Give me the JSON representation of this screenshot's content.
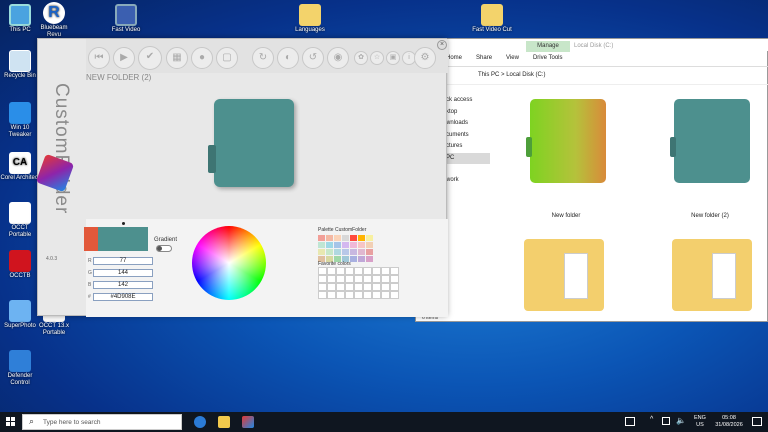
{
  "desktop": {
    "icons": [
      {
        "label": "This PC"
      },
      {
        "label": "Bluebeam Revu"
      },
      {
        "label": "Fast Video"
      },
      {
        "label": "Languages"
      },
      {
        "label": "Fast Video Cut"
      },
      {
        "label": "Recycle Bin"
      },
      {
        "label": "Win 10 Tweaker"
      },
      {
        "label": "Corel Architect"
      },
      {
        "label": "OCCT Portable"
      },
      {
        "label": "OCCTB"
      },
      {
        "label": "SuperPhoto"
      },
      {
        "label": "OCCT 13.x Portable"
      },
      {
        "label": "Defender Control"
      }
    ]
  },
  "customfolder": {
    "app_name": "CustomFolder",
    "version": "4.0.3",
    "folder_name": "NEW FOLDER (2)",
    "gradient_label": "Gradient",
    "palette_label": "Palette CustomFolder",
    "favorite_label": "Favorite colors",
    "rgb": {
      "r_label": "R",
      "g_label": "G",
      "b_label": "B",
      "hex_label": "#",
      "r": "77",
      "g": "144",
      "b": "142",
      "hex": "#4D908E"
    },
    "colors": {
      "current": "#4D908E",
      "previous": "#e2583a",
      "folder_teal": "#4d908e"
    },
    "palette": [
      "#f29f98",
      "#f4b8a3",
      "#fbd3b8",
      "#d8d8d8",
      "#ff4a3d",
      "#ffb300",
      "#f7f0a0",
      "#bfe6d4",
      "#9ed8e6",
      "#a6c5e8",
      "#d4b8f0",
      "#f0b8d8",
      "#f7c5c5",
      "#f2d0b5",
      "#e8e8b0",
      "#c8e8c8",
      "#b0d8e0",
      "#b8c8e8",
      "#c8b8e0",
      "#e0b8d0",
      "#e8a0a0",
      "#e0c0a0",
      "#d8d8a0",
      "#a0d8a8",
      "#a0c8d8",
      "#a8b0e0",
      "#c0a8d8",
      "#d8a0c8"
    ]
  },
  "explorer": {
    "ribbon_manage": "Manage",
    "ribbon_location": "Local Disk (C:)",
    "tabs": [
      "Home",
      "Share",
      "View",
      "Drive Tools"
    ],
    "breadcrumb": [
      "This PC",
      "Local Disk (C:)"
    ],
    "nav": [
      "ck access",
      "ktop",
      "wnloads",
      "cuments",
      "ctures",
      "PC",
      "work"
    ],
    "items": [
      {
        "label": "New folder"
      },
      {
        "label": "New folder (2)"
      }
    ],
    "status": "6 items"
  },
  "taskbar": {
    "search_placeholder": "Type here to search",
    "lang": "ENG",
    "region": "US",
    "time": "05:08",
    "date": "31/08/2026"
  }
}
